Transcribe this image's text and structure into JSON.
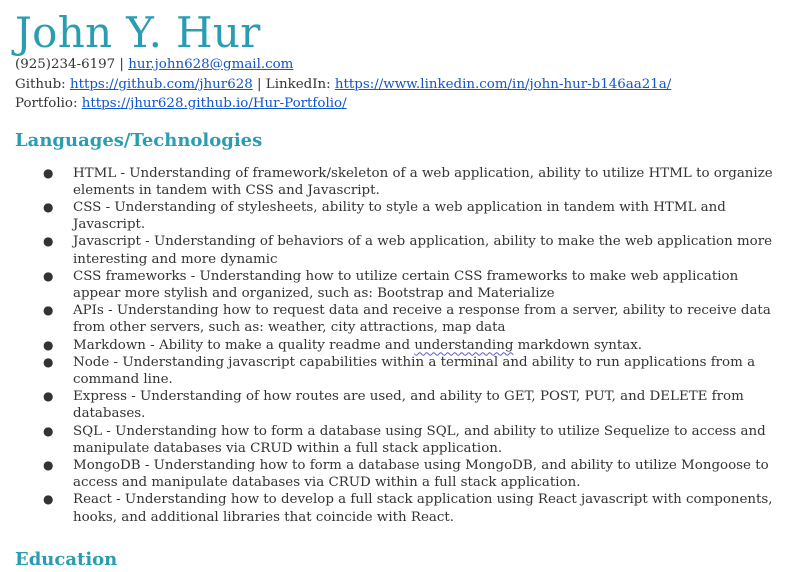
{
  "header": {
    "name": "John Y. Hur",
    "phone": "(925)234-6197",
    "sep1": " | ",
    "email": "hur.john628@gmail.com",
    "github_label": "Github: ",
    "github_url": "https://github.com/jhur628",
    "sep2": " | ",
    "linkedin_label": "LinkedIn: ",
    "linkedin_url": "https://www.linkedin.com/in/john-hur-b146aa21a/",
    "portfolio_label": "Portfolio: ",
    "portfolio_url": "https://jhur628.github.io/Hur-Portfolio/"
  },
  "languages": {
    "heading": "Languages/Technologies",
    "bullet": "●",
    "items": [
      "HTML - Understanding of framework/skeleton of a web application, ability to utilize HTML to organize elements in tandem with CSS and Javascript.",
      "CSS - Understanding of stylesheets, ability to style a web application in tandem with HTML and Javascript.",
      "Javascript - Understanding of behaviors of a web application, ability to make the web application more interesting and more dynamic",
      "CSS frameworks - Understanding how to utilize certain CSS frameworks to make web application appear more stylish and organized, such as: Bootstrap and Materialize",
      "APIs - Understanding how to request data and receive a response from a server, ability to receive data from other servers, such as: weather, city attractions, map data",
      "Markdown - Ability to make a quality readme and ",
      "Node - Understanding javascript capabilities within a terminal and ability to run applications from a command line.",
      "Express - Understanding of how routes are used, and ability to GET, POST, PUT, and DELETE from databases.",
      "SQL - Understanding how to form a database using SQL, and ability to utilize Sequelize to access and manipulate databases via CRUD within a full stack application.",
      "MongoDB - Understanding how to form a database using MongoDB, and ability to utilize Mongoose to access and manipulate databases via CRUD within a full stack application.",
      "React - Understanding how to develop a full stack application using React javascript with components, hooks, and additional libraries that coincide with React."
    ],
    "markdown_squiggle": "understanding",
    "markdown_tail": " markdown syntax."
  },
  "education": {
    "heading": "Education"
  }
}
